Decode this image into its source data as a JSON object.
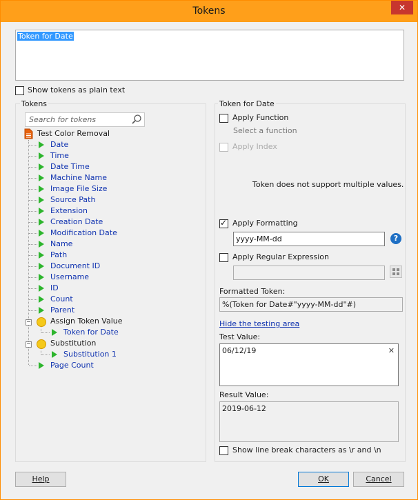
{
  "window": {
    "title": "Tokens",
    "close_label": "✕"
  },
  "token_editor": {
    "selected_text": "Token for Date"
  },
  "show_plain": {
    "label": "Show tokens as plain text",
    "checked": false
  },
  "tokens_panel": {
    "group_label": "Tokens",
    "search_placeholder": "Search for tokens",
    "root": "Test Color Removal",
    "items": [
      "Date",
      "Time",
      "Date Time",
      "Machine Name",
      "Image File Size",
      "Source Path",
      "Extension",
      "Creation Date",
      "Modification Date",
      "Name",
      "Path",
      "Document ID",
      "Username",
      "ID",
      "Count",
      "Parent"
    ],
    "assign": {
      "label": "Assign Token Value",
      "child": "Token for Date"
    },
    "substitution": {
      "label": "Substitution",
      "child": "Substitution 1"
    },
    "last": "Page Count"
  },
  "detail": {
    "group_label": "Token for Date",
    "apply_function": {
      "label": "Apply Function",
      "checked": false
    },
    "select_function": "Select a function",
    "apply_index": {
      "label": "Apply Index",
      "checked": false
    },
    "multi_values_note": "Token does not support multiple values.",
    "apply_formatting": {
      "label": "Apply Formatting",
      "checked": true,
      "value": "yyyy-MM-dd"
    },
    "apply_regex": {
      "label": "Apply Regular Expression",
      "checked": false,
      "value": ""
    },
    "formatted_token_label": "Formatted Token:",
    "formatted_token_value": "%(Token for Date#\"yyyy-MM-dd\"#)",
    "hide_testing_link": "Hide the testing area",
    "test_value_label": "Test Value:",
    "test_value": "06/12/19",
    "clear_icon": "✕",
    "result_value_label": "Result Value:",
    "result_value": "2019-06-12",
    "show_line_breaks": {
      "label": "Show line break characters as \\r and \\n",
      "checked": false
    }
  },
  "footer": {
    "help_label": "Help",
    "ok_label": "OK",
    "cancel_label": "Cancel"
  },
  "colors": {
    "title_bar": "#ff9f1a",
    "link": "#1033b0",
    "selection": "#3399ff",
    "close": "#c7362e"
  }
}
